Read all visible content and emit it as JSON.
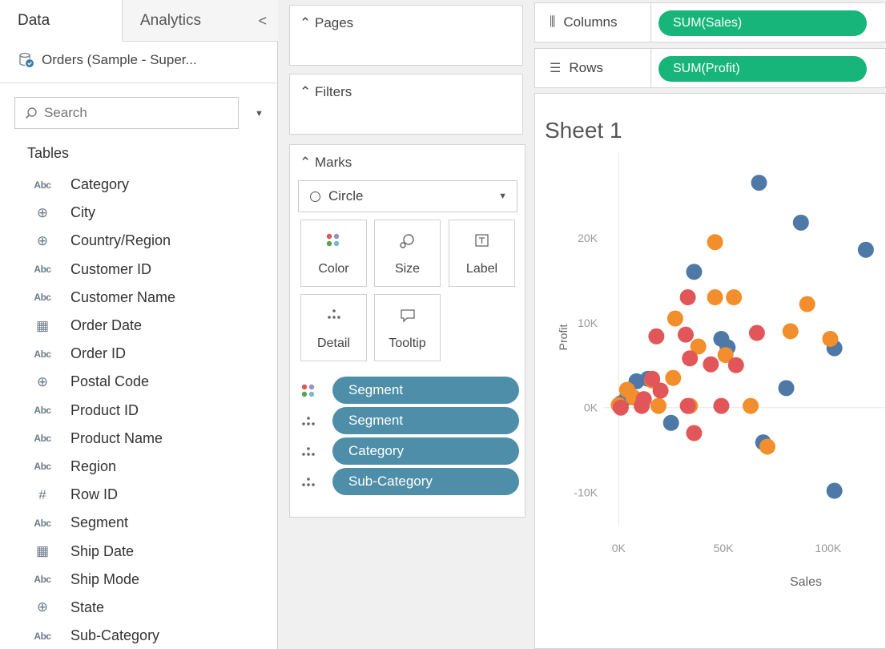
{
  "data_pane": {
    "tabs": [
      {
        "label": "Data"
      },
      {
        "label": "Analytics"
      }
    ],
    "collapse_glyph": "<",
    "datasource_name": "Orders (Sample - Super...",
    "search": {
      "placeholder": "Search"
    },
    "tables_heading": "Tables",
    "fields": [
      {
        "type": "string",
        "type_label": "Abc",
        "name": "Category"
      },
      {
        "type": "geo",
        "type_label": "⊕",
        "name": "City"
      },
      {
        "type": "geo",
        "type_label": "⊕",
        "name": "Country/Region"
      },
      {
        "type": "string",
        "type_label": "Abc",
        "name": "Customer ID"
      },
      {
        "type": "string",
        "type_label": "Abc",
        "name": "Customer Name"
      },
      {
        "type": "date",
        "type_label": "▦",
        "name": "Order Date"
      },
      {
        "type": "string",
        "type_label": "Abc",
        "name": "Order ID"
      },
      {
        "type": "geo",
        "type_label": "⊕",
        "name": "Postal Code"
      },
      {
        "type": "string",
        "type_label": "Abc",
        "name": "Product ID"
      },
      {
        "type": "string",
        "type_label": "Abc",
        "name": "Product Name"
      },
      {
        "type": "string",
        "type_label": "Abc",
        "name": "Region"
      },
      {
        "type": "number",
        "type_label": "#",
        "name": "Row ID"
      },
      {
        "type": "string",
        "type_label": "Abc",
        "name": "Segment"
      },
      {
        "type": "date",
        "type_label": "▦",
        "name": "Ship Date"
      },
      {
        "type": "string",
        "type_label": "Abc",
        "name": "Ship Mode"
      },
      {
        "type": "geo",
        "type_label": "⊕",
        "name": "State"
      },
      {
        "type": "string",
        "type_label": "Abc",
        "name": "Sub-Category"
      }
    ]
  },
  "cards": {
    "pages": "Pages",
    "filters": "Filters",
    "marks": "Marks",
    "mark_type": "Circle",
    "mark_buttons": {
      "color": "Color",
      "size": "Size",
      "label": "Label",
      "detail": "Detail",
      "tooltip": "Tooltip"
    },
    "mark_pills": [
      {
        "encoding": "color",
        "icon": "color-dots-icon",
        "label": "Segment"
      },
      {
        "encoding": "detail",
        "icon": "detail-dots-icon",
        "label": "Segment"
      },
      {
        "encoding": "detail",
        "icon": "detail-dots-icon",
        "label": "Category"
      },
      {
        "encoding": "detail",
        "icon": "detail-dots-icon",
        "label": "Sub-Category"
      }
    ]
  },
  "shelves": {
    "columns_label": "Columns",
    "columns_pill": "SUM(Sales)",
    "rows_label": "Rows",
    "rows_pill": "SUM(Profit)"
  },
  "colors": {
    "pill_blue": "#4e8ea9",
    "pill_green": "#17b57a",
    "series_consumer": "#4e79a7",
    "series_corporate": "#f28e2b",
    "series_home_office": "#e15759"
  },
  "chart_data": {
    "type": "scatter",
    "title": "Sheet 1",
    "xlabel": "Sales",
    "ylabel": "Profit",
    "xticks": [
      "0K",
      "50K",
      "100K"
    ],
    "yticks": [
      "20K",
      "10K",
      "0K",
      "-10K"
    ],
    "xlim": [
      -7000,
      128000
    ],
    "ylim": [
      -14000,
      30000
    ],
    "grid": false,
    "series": [
      {
        "color": "#4e79a7",
        "points": [
          [
            67000,
            26500
          ],
          [
            87000,
            21800
          ],
          [
            118000,
            18600
          ],
          [
            36000,
            16000
          ],
          [
            49000,
            8100
          ],
          [
            52000,
            7100
          ],
          [
            103000,
            7000
          ],
          [
            8500,
            3100
          ],
          [
            14000,
            3400
          ],
          [
            4000,
            1200
          ],
          [
            1000,
            500
          ],
          [
            80000,
            2300
          ],
          [
            25000,
            -1800
          ],
          [
            69000,
            -4100
          ],
          [
            103000,
            -9800
          ]
        ]
      },
      {
        "color": "#f28e2b",
        "points": [
          [
            46000,
            19500
          ],
          [
            46000,
            13000
          ],
          [
            55000,
            13000
          ],
          [
            27000,
            10500
          ],
          [
            90000,
            12200
          ],
          [
            82000,
            9000
          ],
          [
            101000,
            8100
          ],
          [
            38000,
            7200
          ],
          [
            51000,
            6200
          ],
          [
            26000,
            3500
          ],
          [
            16000,
            3200
          ],
          [
            4000,
            2100
          ],
          [
            7000,
            1200
          ],
          [
            19000,
            200
          ],
          [
            34000,
            200
          ],
          [
            63000,
            200
          ],
          [
            0,
            300
          ],
          [
            71000,
            -4600
          ]
        ]
      },
      {
        "color": "#e15759",
        "points": [
          [
            33000,
            13000
          ],
          [
            32000,
            8600
          ],
          [
            18000,
            8400
          ],
          [
            66000,
            8800
          ],
          [
            34000,
            5800
          ],
          [
            44000,
            5100
          ],
          [
            56000,
            5000
          ],
          [
            16000,
            3400
          ],
          [
            20000,
            2000
          ],
          [
            12000,
            1000
          ],
          [
            11000,
            200
          ],
          [
            49000,
            200
          ],
          [
            33000,
            200
          ],
          [
            1000,
            0
          ],
          [
            36000,
            -3000
          ]
        ]
      }
    ]
  }
}
